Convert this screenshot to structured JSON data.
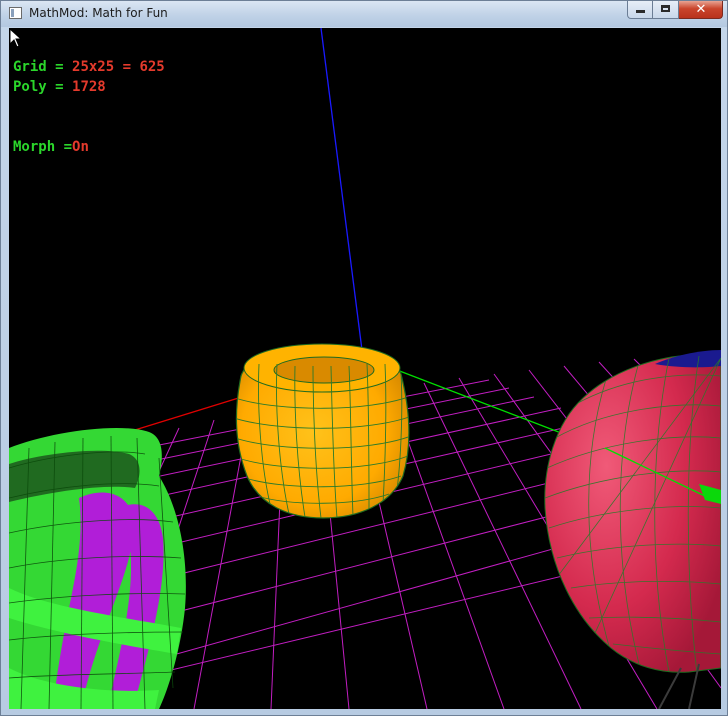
{
  "window": {
    "title": "MathMod: Math for Fun",
    "buttons": {
      "minimize": "minimize",
      "maximize": "maximize",
      "close": "✕"
    }
  },
  "hud": {
    "grid_label": "Grid = ",
    "grid_value": "25x25 = 625",
    "poly_label": "Poly = ",
    "poly_value": "1728",
    "morph_label": "Morph =",
    "morph_value": "On"
  },
  "colors": {
    "hud_label": "#2bd62b",
    "hud_value": "#e43a2c",
    "floor_grid": "#c21ec2",
    "axis_x": "#e00000",
    "axis_y": "#00e000",
    "axis_z": "#1a1aff",
    "barrel": "#ffb300",
    "sphere": "#d42a4e",
    "ribbon_green": "#3ff23f",
    "ribbon_purple": "#b11ed8"
  },
  "icons": [
    "app-icon",
    "minimize-icon",
    "maximize-icon",
    "close-icon",
    "arrow-cursor-icon"
  ]
}
